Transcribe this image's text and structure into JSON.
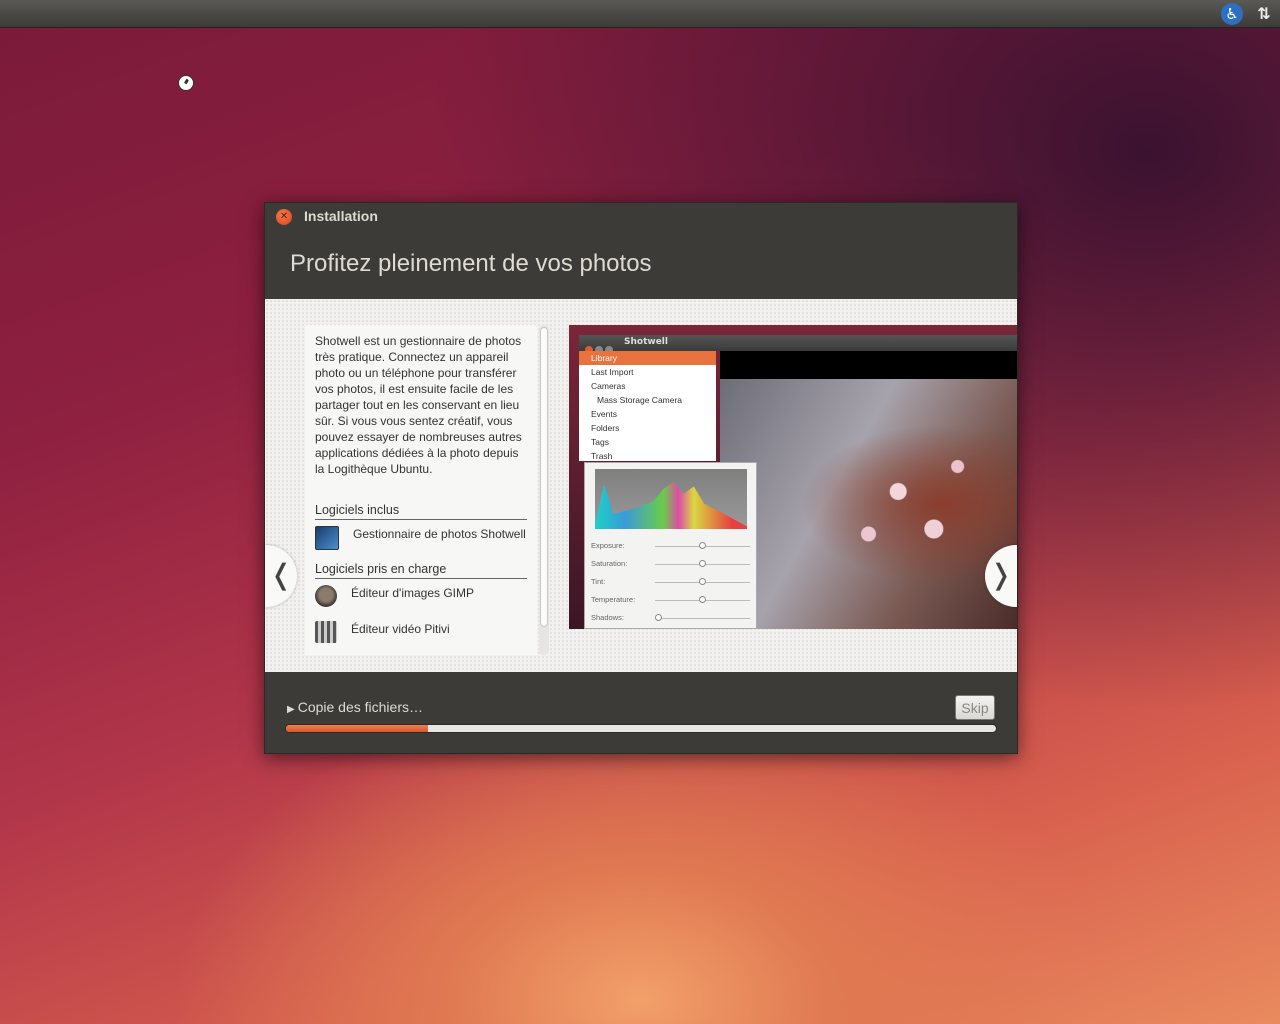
{
  "topbar": {
    "accessibility_icon": "accessibility-icon",
    "network_icon": "network-arrows-icon"
  },
  "window": {
    "title": "Installation",
    "slide_title": "Profitez pleinement de vos photos",
    "description": "Shotwell est un gestionnaire de photos très pratique. Connectez un appareil photo ou un téléphone pour transférer vos photos, il est ensuite facile de les partager tout en les conservant en lieu sûr. Si vous vous sentez créatif, vous pouvez essayer de nombreuses autres applications dédiées à la photo depuis la Logithèque Ubuntu.",
    "included_heading": "Logiciels inclus",
    "included_apps": [
      {
        "name": "Gestionnaire de photos Shotwell",
        "icon": "shotwell-icon"
      }
    ],
    "supported_heading": "Logiciels pris en charge",
    "supported_apps": [
      {
        "name": "Éditeur d'images GIMP",
        "icon": "gimp-icon"
      },
      {
        "name": "Éditeur vidéo Pitivi",
        "icon": "pitivi-icon"
      }
    ],
    "nav_prev": "❬",
    "nav_next": "❭"
  },
  "screenshot": {
    "app_title": "Shotwell",
    "sidebar": [
      "Library",
      "Last Import",
      "Cameras",
      "Mass Storage Camera",
      "Events",
      "Folders",
      "Tags",
      "Trash"
    ],
    "adjustments": [
      "Exposure:",
      "Saturation:",
      "Tint:",
      "Temperature:",
      "Shadows:"
    ]
  },
  "footer": {
    "status": "Copie des fichiers…",
    "skip_label": "Skip",
    "progress_fraction": 0.2
  },
  "colors": {
    "accent": "#e8733f",
    "window_bg": "#3c3b37"
  }
}
